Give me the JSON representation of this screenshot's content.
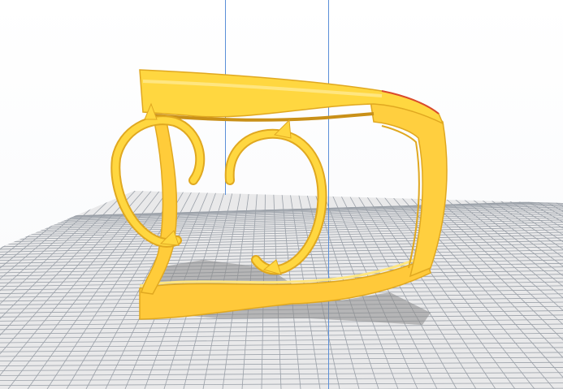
{
  "viewport": {
    "background_color": "#ffffff",
    "build_plate_color": "#e9e9ea",
    "grid_line_color": "#9aa0a8",
    "axis_line_color": "#5b8fd8",
    "model_color": "#ffd740",
    "model_shade_color": "#e0a820",
    "model_highlight_color": "#ffe680",
    "model_edge_color": "#d94a2c",
    "shadow_color": "#8a8a8a"
  }
}
